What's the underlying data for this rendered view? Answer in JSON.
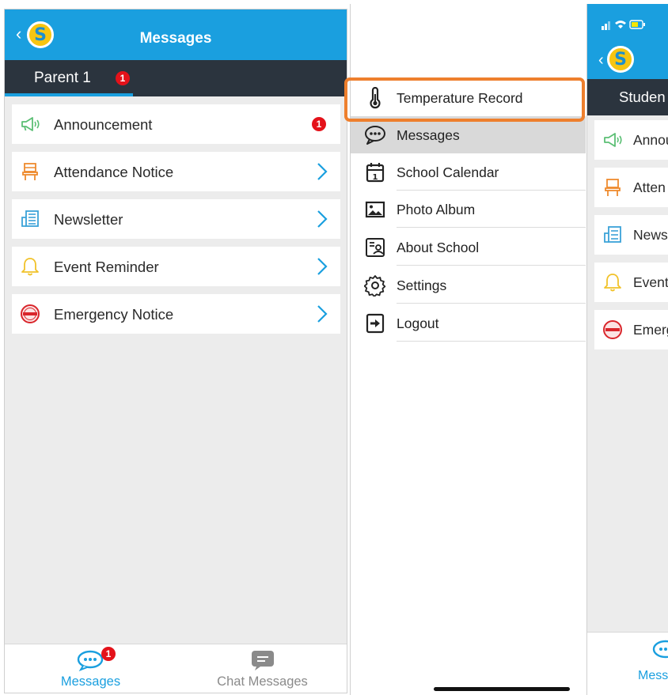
{
  "left_screen": {
    "header_title": "Messages",
    "tab": {
      "label": "Parent 1",
      "badge": "1"
    },
    "items": [
      {
        "label": "Announcement",
        "icon": "megaphone-icon",
        "badge": "1"
      },
      {
        "label": "Attendance Notice",
        "icon": "chair-icon"
      },
      {
        "label": "Newsletter",
        "icon": "newsletter-icon"
      },
      {
        "label": "Event Reminder",
        "icon": "bell-icon"
      },
      {
        "label": "Emergency Notice",
        "icon": "urgent-stamp-icon"
      }
    ],
    "bottom_tabs": [
      {
        "label": "Messages",
        "badge": "1",
        "active": true
      },
      {
        "label": "Chat Messages",
        "active": false
      }
    ]
  },
  "side_menu": {
    "items": [
      {
        "label": "Temperature Record",
        "icon": "thermometer-icon",
        "highlighted": true
      },
      {
        "label": "Messages",
        "icon": "chat-bubble-icon",
        "selected": true
      },
      {
        "label": "School Calendar",
        "icon": "calendar-icon"
      },
      {
        "label": "Photo Album",
        "icon": "photo-icon"
      },
      {
        "label": "About School",
        "icon": "about-card-icon"
      },
      {
        "label": "Settings",
        "icon": "gear-icon"
      },
      {
        "label": "Logout",
        "icon": "logout-icon"
      }
    ],
    "highlight_color": "#ee7f2d"
  },
  "right_screen": {
    "tab_label": "Studen",
    "items": [
      {
        "label": "Annou",
        "icon": "megaphone-icon"
      },
      {
        "label": "Atten",
        "icon": "chair-icon"
      },
      {
        "label": "News",
        "icon": "newsletter-icon"
      },
      {
        "label": "Event",
        "icon": "bell-icon"
      },
      {
        "label": "Emerg",
        "icon": "urgent-stamp-icon"
      }
    ],
    "bottom_tab_label": "Mess"
  },
  "colors": {
    "primary_blue": "#1a9fdf",
    "tab_bar_dark": "#2b343e",
    "badge_red": "#e4121a",
    "background_grey": "#ececec",
    "inactive_grey": "#8a8a8a"
  }
}
